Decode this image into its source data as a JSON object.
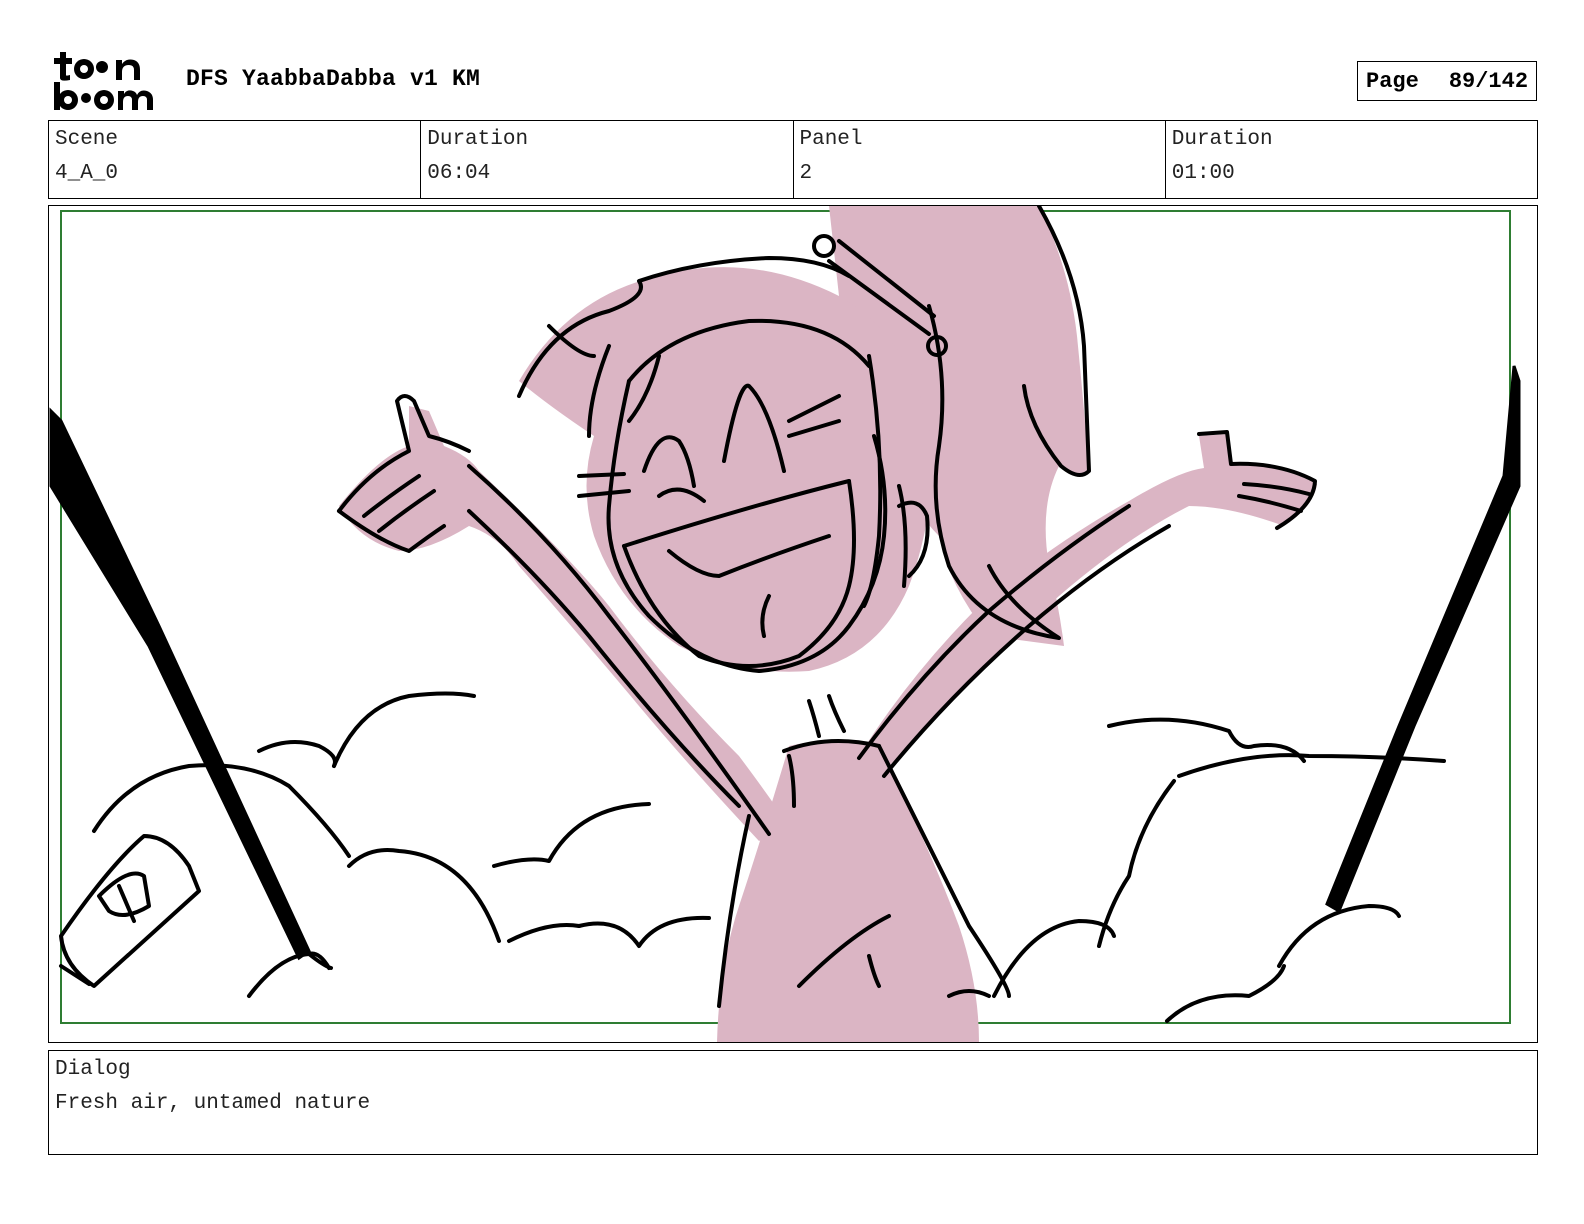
{
  "header": {
    "logo_text": "toon boom",
    "title": "DFS YaabbaDabba v1 KM",
    "page_label": "Page",
    "page_value": "89/142"
  },
  "info": {
    "scene_label": "Scene",
    "scene_value": "4_A_0",
    "duration_label": "Duration",
    "duration_value": "06:04",
    "panel_label": "Panel",
    "panel_value": "2",
    "panel_duration_label": "Duration",
    "panel_duration_value": "01:00"
  },
  "dialog": {
    "label": "Dialog",
    "text": "Fresh air, untamed nature"
  },
  "colors": {
    "fill": "#dbb5c4",
    "line": "#000000",
    "frame_green": "#2e7d32"
  }
}
